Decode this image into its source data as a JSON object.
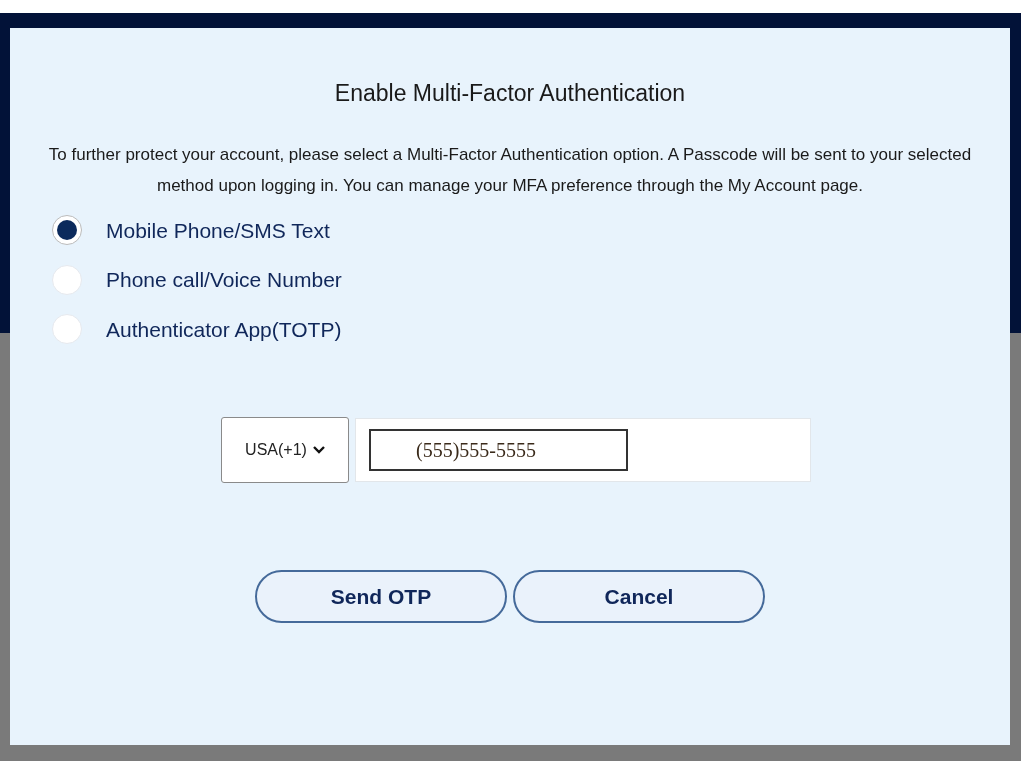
{
  "dialog": {
    "title": "Enable Multi-Factor Authentication",
    "message": "To further protect your account, please select a Multi-Factor Authentication option. A Passcode will be sent to your selected method upon logging in. You can manage your MFA preference through the My Account page.",
    "options": [
      {
        "label": "Mobile Phone/SMS Text",
        "selected": true
      },
      {
        "label": "Phone call/Voice Number",
        "selected": false
      },
      {
        "label": "Authenticator App(TOTP)",
        "selected": false
      }
    ],
    "country_select": {
      "value": "USA(+1)"
    },
    "phone_field": {
      "value": "(555)555-5555"
    },
    "buttons": [
      "Send OTP",
      "Cancel"
    ]
  }
}
